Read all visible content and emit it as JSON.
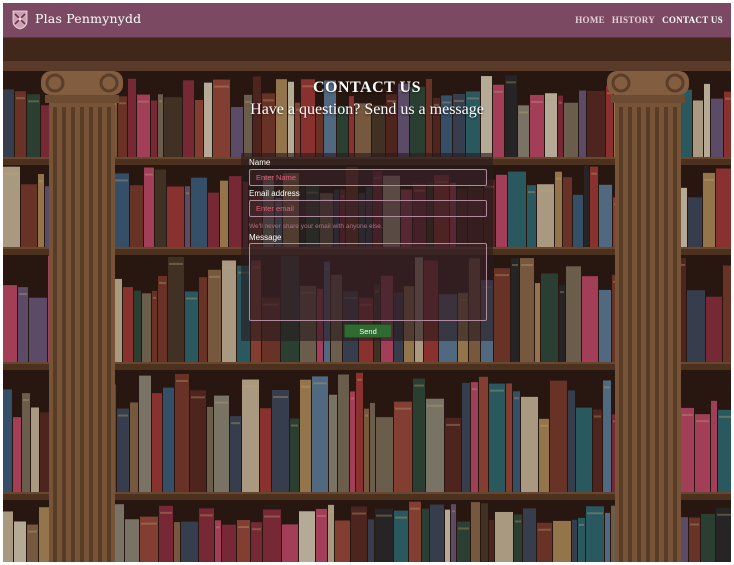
{
  "brand": {
    "name": "Plas Penmynydd",
    "logo_icon": "crest-icon"
  },
  "nav": {
    "items": [
      {
        "label": "HOME",
        "active": false
      },
      {
        "label": "HISTORY",
        "active": false
      },
      {
        "label": "CONTACT US",
        "active": true
      }
    ]
  },
  "hero": {
    "title": "CONTACT US",
    "subtitle": "Have a question? Send us a message"
  },
  "form": {
    "name_label": "Name",
    "name_placeholder": "Enter Name",
    "email_label": "Email address",
    "email_placeholder": "Enter email",
    "email_help": "We'll never share your email with anyone else.",
    "message_label": "Message",
    "submit_label": "Send"
  },
  "colors": {
    "navbar": "#7b4a62",
    "submit_button": "#2f6a30",
    "placeholder_text": "#e0607a"
  }
}
